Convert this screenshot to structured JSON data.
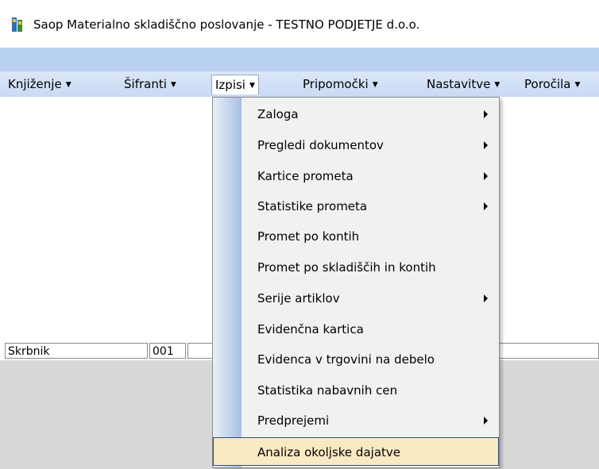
{
  "window": {
    "title": "Saop  Materialno skladiščno poslovanje - TESTNO PODJETJE d.o.o.",
    "app_icon": "saop-app-icon"
  },
  "menubar": {
    "items": [
      {
        "label": "Knjiženje",
        "arrow": "▼"
      },
      {
        "label": "Šifranti",
        "arrow": "▼"
      },
      {
        "label": "Izpisi",
        "arrow": "▼"
      },
      {
        "label": "Pripomočki",
        "arrow": "▼"
      },
      {
        "label": "Nastavitve",
        "arrow": "▼"
      },
      {
        "label": "Poročila",
        "arrow": "▼"
      }
    ]
  },
  "statusbar": {
    "field1": "Skrbnik",
    "field2": "001"
  },
  "izpisi_menu": {
    "items": [
      {
        "label": "Zaloga",
        "submenu": true
      },
      {
        "label": "Pregledi dokumentov",
        "submenu": true
      },
      {
        "label": "Kartice prometa",
        "submenu": true
      },
      {
        "label": "Statistike prometa",
        "submenu": true
      },
      {
        "label": "Promet po kontih",
        "submenu": false
      },
      {
        "label": "Promet po skladiščih in kontih",
        "submenu": false
      },
      {
        "label": "Serije artiklov",
        "submenu": true
      },
      {
        "label": "Evidenčna kartica",
        "submenu": false
      },
      {
        "label": "Evidenca v trgovini na debelo",
        "submenu": false
      },
      {
        "label": "Statistika nabavnih cen",
        "submenu": false
      },
      {
        "label": "Predprejemi",
        "submenu": true
      },
      {
        "label": "Analiza okoljske dajatve",
        "submenu": false
      }
    ],
    "highlighted": "Analiza okoljske dajatve"
  },
  "colors": {
    "menubar": "#c9daf3",
    "highlight_bg": "#fbe9c4",
    "highlight_border": "#2e4d86"
  }
}
